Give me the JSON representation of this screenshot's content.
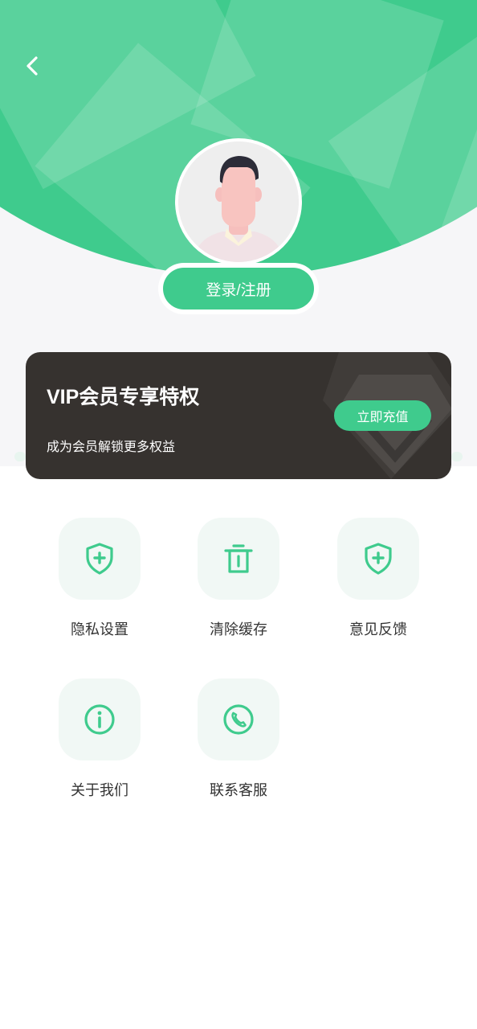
{
  "header": {
    "back_icon": "chevron-left-icon",
    "login_label": "登录/注册"
  },
  "vip": {
    "title": "VIP会员专享特权",
    "subtitle": "成为会员解锁更多权益",
    "recharge_label": "立即充值"
  },
  "menu": [
    {
      "label": "隐私设置",
      "icon": "shield-plus-icon"
    },
    {
      "label": "清除缓存",
      "icon": "trash-icon"
    },
    {
      "label": "意见反馈",
      "icon": "shield-plus-icon"
    },
    {
      "label": "关于我们",
      "icon": "info-circle-icon"
    },
    {
      "label": "联系客服",
      "icon": "phone-icon"
    }
  ],
  "colors": {
    "brand_green": "#3fcb8d",
    "card_dark": "#36322f",
    "tile_bg": "#f1f8f5",
    "text": "#333333"
  }
}
